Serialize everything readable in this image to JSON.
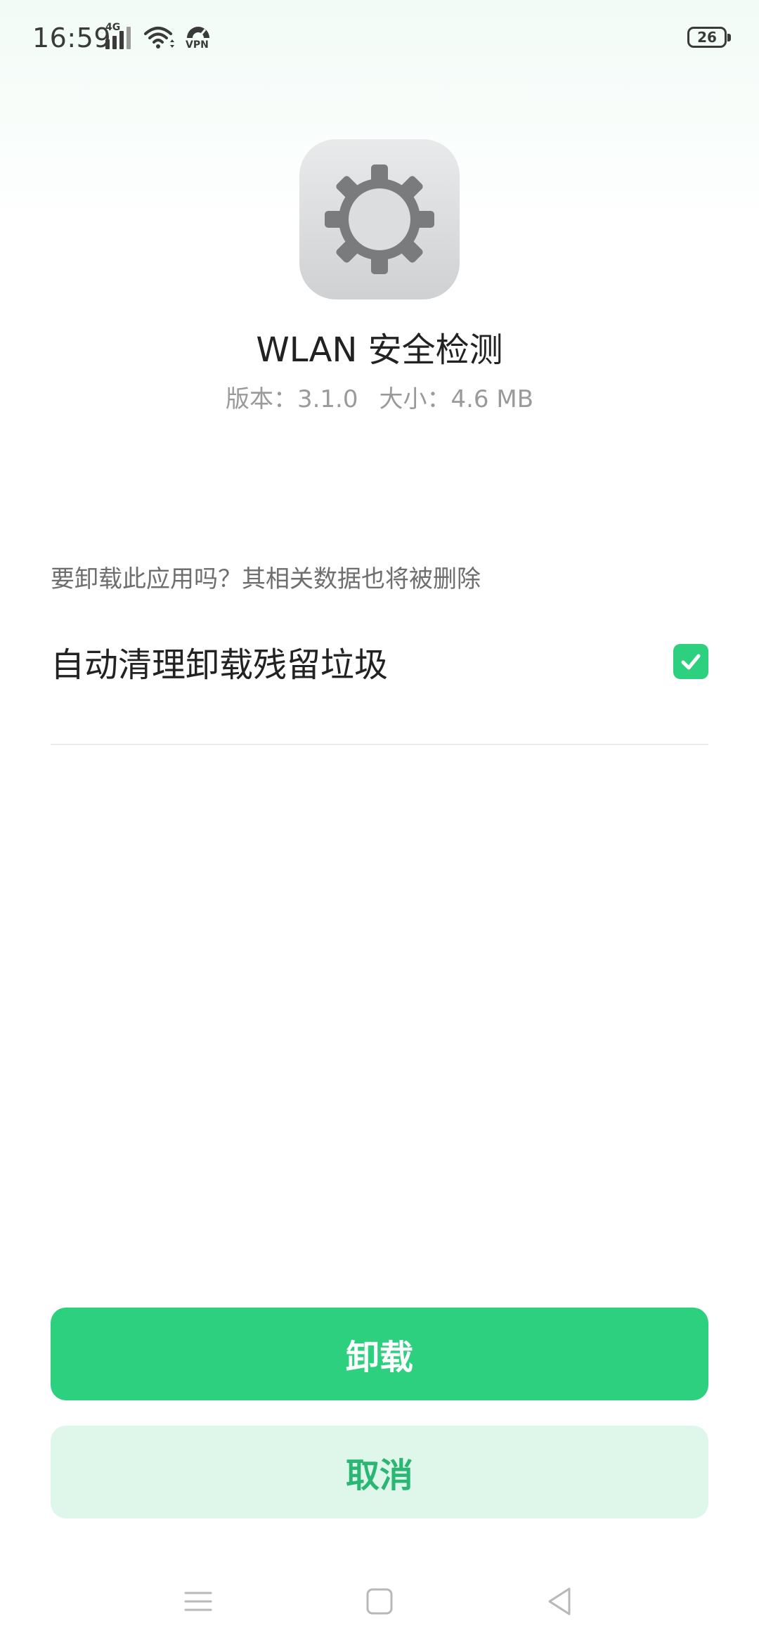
{
  "status_bar": {
    "time": "16:59",
    "network_type": "4G",
    "vpn_label": "VPN",
    "battery_level": "26",
    "icons": [
      "signal-icon",
      "wifi-icon",
      "vpn-icon",
      "battery-icon"
    ]
  },
  "app": {
    "icon": "gear-icon",
    "name": "WLAN 安全检测",
    "version": "版本：3.1.0",
    "size": "大小：4.6 MB"
  },
  "uninstall": {
    "question": "要卸载此应用吗？其相关数据也将被删除",
    "auto_clean_label": "自动清理卸载残留垃圾",
    "auto_clean_checked": true
  },
  "buttons": {
    "uninstall_label": "卸载",
    "cancel_label": "取消"
  },
  "nav_bar": {
    "icons": [
      "menu-icon",
      "home-icon",
      "back-icon"
    ]
  },
  "colors": {
    "accent": "#2dd07f",
    "cancel_bg": "#dff6ea",
    "cancel_text": "#2ab673"
  }
}
